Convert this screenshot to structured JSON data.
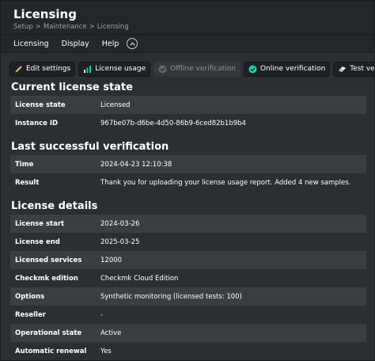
{
  "header": {
    "title": "Licensing",
    "breadcrumbs": [
      "Setup",
      "Maintenance",
      "Licensing"
    ],
    "breadcrumb_sep": ">"
  },
  "menubar": {
    "items": [
      "Licensing",
      "Display",
      "Help"
    ],
    "toggle_icon": "chevron-up-icon"
  },
  "toolbar": {
    "buttons": [
      {
        "label": "Edit settings",
        "icon": "pencil-icon",
        "disabled": false
      },
      {
        "label": "License usage",
        "icon": "bar-chart-icon",
        "disabled": false
      },
      {
        "label": "Offline verification",
        "icon": "check-circle-icon",
        "disabled": true
      },
      {
        "label": "Online verification",
        "icon": "check-circle-icon",
        "disabled": false
      },
      {
        "label": "Test verification",
        "icon": "eraser-icon",
        "disabled": false
      }
    ]
  },
  "sections": {
    "current_state": {
      "title": "Current license state",
      "rows": [
        {
          "key": "License state",
          "value": "Licensed"
        },
        {
          "key": "Instance ID",
          "value": "967be07b-d6be-4d50-86b9-6ced82b1b9b4"
        }
      ]
    },
    "last_verification": {
      "title": "Last successful verification",
      "rows": [
        {
          "key": "Time",
          "value": "2024-04-23 12:10:38"
        },
        {
          "key": "Result",
          "value": "Thank you for uploading your license usage report. Added 4 new samples."
        }
      ]
    },
    "details": {
      "title": "License details",
      "rows": [
        {
          "key": "License start",
          "value": "2024-03-26"
        },
        {
          "key": "License end",
          "value": "2025-03-25"
        },
        {
          "key": "Licensed services",
          "value": "12000"
        },
        {
          "key": "Checkmk edition",
          "value": "Checkmk Cloud Edition"
        },
        {
          "key": "Options",
          "value": "Synthetic monitoring (licensed tests: 100)"
        },
        {
          "key": "Reseller",
          "value": "-"
        },
        {
          "key": "Operational state",
          "value": "Active"
        },
        {
          "key": "Automatic renewal",
          "value": "Yes"
        }
      ]
    }
  },
  "colors": {
    "background": "#2b2e32",
    "row_alt": "#3a3e43",
    "header_bg": "#23262a",
    "accent_green": "#15d1a0"
  }
}
